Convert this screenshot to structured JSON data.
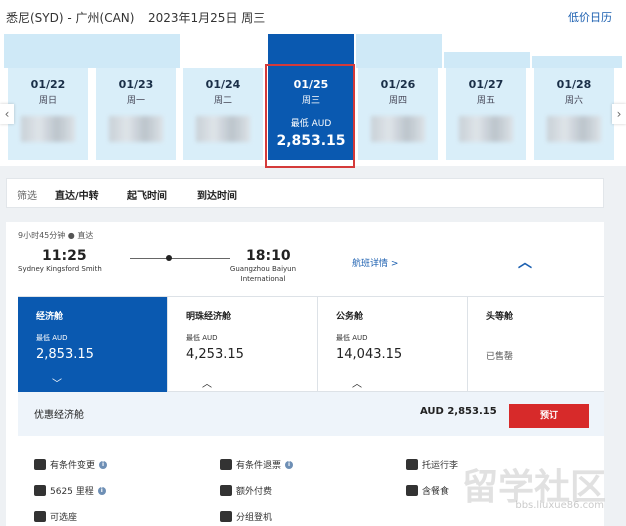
{
  "header": {
    "route": "悉尼(SYD) - 广州(CAN)",
    "date": "2023年1月25日 周三",
    "calendar_link": "低价日历"
  },
  "dates": [
    {
      "date": "01/22",
      "weekday": "周日"
    },
    {
      "date": "01/23",
      "weekday": "周一"
    },
    {
      "date": "01/24",
      "weekday": "周二"
    },
    {
      "date": "01/25",
      "weekday": "周三",
      "label": "最低 AUD",
      "price": "2,853.15",
      "selected": true
    },
    {
      "date": "01/26",
      "weekday": "周四"
    },
    {
      "date": "01/27",
      "weekday": "周五"
    },
    {
      "date": "01/28",
      "weekday": "周六"
    }
  ],
  "filter": {
    "label": "筛选",
    "items": [
      "直达/中转",
      "起飞时间",
      "到达时间"
    ]
  },
  "flight": {
    "meta": "9小时45分钟 ● 直达",
    "dep_time": "11:25",
    "dep_airport": "Sydney Kingsford Smith",
    "arr_time": "18:10",
    "arr_airport": "Guangzhou Baiyun International",
    "detail_link": "航班详情 >"
  },
  "cabins": [
    {
      "name": "经济舱",
      "label": "最低 AUD",
      "price": "2,853.15",
      "active": true
    },
    {
      "name": "明珠经济舱",
      "label": "最低 AUD",
      "price": "4,253.15"
    },
    {
      "name": "公务舱",
      "label": "最低 AUD",
      "price": "14,043.15"
    },
    {
      "name": "头等舱",
      "status": "已售罄"
    }
  ],
  "fare": {
    "name": "优惠经济舱",
    "amount": "AUD 2,853.15",
    "book": "预订"
  },
  "features": [
    "有条件变更",
    "有条件退票",
    "托运行李",
    "5625 里程",
    "额外付费",
    "含餐食",
    "可选座",
    "分组登机"
  ],
  "watermark": {
    "text": "留学社区",
    "url": "bbs.liuxue86.com"
  }
}
